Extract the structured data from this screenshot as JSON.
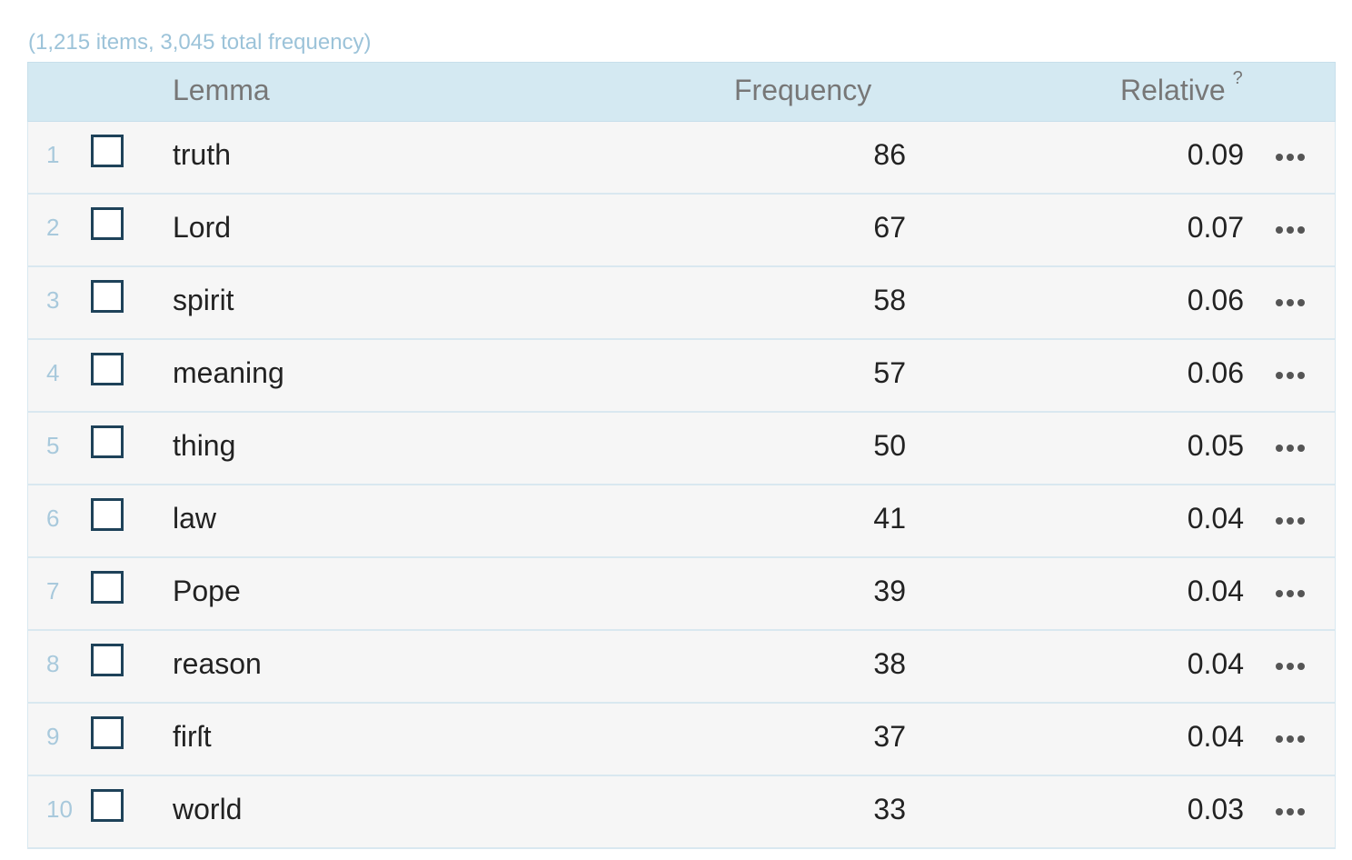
{
  "summary": "(1,215 items, 3,045 total frequency)",
  "columns": {
    "lemma": "Lemma",
    "frequency": "Frequency",
    "relative": "Relative",
    "relative_help": "?"
  },
  "rows": [
    {
      "num": "1",
      "lemma": "truth",
      "frequency": "86",
      "relative": "0.09"
    },
    {
      "num": "2",
      "lemma": "Lord",
      "frequency": "67",
      "relative": "0.07"
    },
    {
      "num": "3",
      "lemma": "spirit",
      "frequency": "58",
      "relative": "0.06"
    },
    {
      "num": "4",
      "lemma": "meaning",
      "frequency": "57",
      "relative": "0.06"
    },
    {
      "num": "5",
      "lemma": "thing",
      "frequency": "50",
      "relative": "0.05"
    },
    {
      "num": "6",
      "lemma": "law",
      "frequency": "41",
      "relative": "0.04"
    },
    {
      "num": "7",
      "lemma": "Pope",
      "frequency": "39",
      "relative": "0.04"
    },
    {
      "num": "8",
      "lemma": "reason",
      "frequency": "38",
      "relative": "0.04"
    },
    {
      "num": "9",
      "lemma": "firſt",
      "frequency": "37",
      "relative": "0.04"
    },
    {
      "num": "10",
      "lemma": "world",
      "frequency": "33",
      "relative": "0.03"
    }
  ],
  "icons": {
    "row_menu": "more-options-icon",
    "row_select": "checkbox-icon"
  },
  "colors": {
    "header_bg": "#d4e9f2",
    "row_bg": "#f6f6f6",
    "row_border": "#d9e8f0",
    "summary_text": "#9cc3d9",
    "checkbox_border": "#1e4259"
  }
}
